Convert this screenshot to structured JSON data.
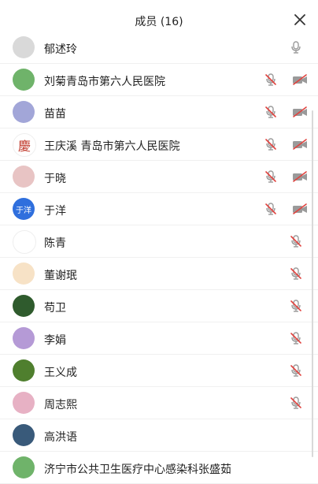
{
  "header": {
    "title": "成员 (16)"
  },
  "members": [
    {
      "name": "郁述玲",
      "avatar_color": "#d9d9d9",
      "avatar_text": "",
      "mic": "on",
      "cam": "none"
    },
    {
      "name": "刘菊青岛市第六人民医院",
      "avatar_color": "#6fb36a",
      "avatar_text": "",
      "mic": "muted",
      "cam": "off"
    },
    {
      "name": "苗苗",
      "avatar_color": "#a2a6d8",
      "avatar_text": "",
      "mic": "muted",
      "cam": "off"
    },
    {
      "name": "王庆溪 青岛市第六人民医院",
      "avatar_color": "#ffffff",
      "avatar_text": "慶",
      "avatar_text_color": "#c0392b",
      "mic": "muted",
      "cam": "off"
    },
    {
      "name": "于晓",
      "avatar_color": "#e8c4c4",
      "avatar_text": "",
      "mic": "muted",
      "cam": "off"
    },
    {
      "name": "于洋",
      "avatar_color": "#2f6fdd",
      "avatar_text": "于洋",
      "mic": "muted",
      "cam": "off"
    },
    {
      "name": "陈青",
      "avatar_color": "#ffffff",
      "avatar_text": "",
      "mic": "muted",
      "cam": "none"
    },
    {
      "name": "董谢珉",
      "avatar_color": "#f7e2c6",
      "avatar_text": "",
      "mic": "muted",
      "cam": "none"
    },
    {
      "name": "苟卫",
      "avatar_color": "#2f5b2d",
      "avatar_text": "",
      "mic": "muted",
      "cam": "none"
    },
    {
      "name": "李娟",
      "avatar_color": "#b59ad6",
      "avatar_text": "",
      "mic": "muted",
      "cam": "none"
    },
    {
      "name": "王义成",
      "avatar_color": "#4f7f2e",
      "avatar_text": "",
      "mic": "muted",
      "cam": "none"
    },
    {
      "name": "周志熙",
      "avatar_color": "#e7b1c4",
      "avatar_text": "",
      "mic": "muted",
      "cam": "none"
    },
    {
      "name": "高洪语",
      "avatar_color": "#395a7a",
      "avatar_text": "",
      "mic": "none",
      "cam": "none"
    },
    {
      "name": "济宁市公共卫生医疗中心感染科张盛茹",
      "avatar_color": "#6fb36a",
      "avatar_text": "",
      "mic": "none",
      "cam": "none"
    }
  ],
  "colors": {
    "icon_gray": "#9a9a9a",
    "muted_red": "#e0433f"
  }
}
